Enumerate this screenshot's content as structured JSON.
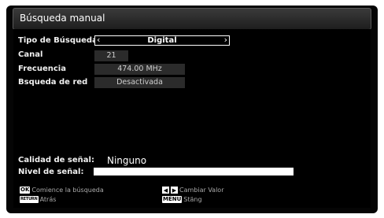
{
  "dialog": {
    "title": "Búsqueda manual"
  },
  "fields": {
    "search_type_label": "Tipo de Búsqueda",
    "search_type_value": "Digital",
    "channel_label": "Canal",
    "channel_value": "21",
    "frequency_label": "Frecuencia",
    "frequency_value": "474.00 MHz",
    "network_label": "Bsqueda de red",
    "network_value": "Desactivada"
  },
  "signal": {
    "quality_label": "Calidad de señal:",
    "quality_value": "Ninguno",
    "level_label": "Nivel de señal:",
    "level_fraction": 1.0
  },
  "help": {
    "ok_key": "OK",
    "ok_text": "Comience la búsqueda",
    "return_key": "RETURN",
    "return_text": "Atrás",
    "lr_text": "Cambiar Valor",
    "menu_key": "MENU",
    "menu_text": "Stäng"
  }
}
